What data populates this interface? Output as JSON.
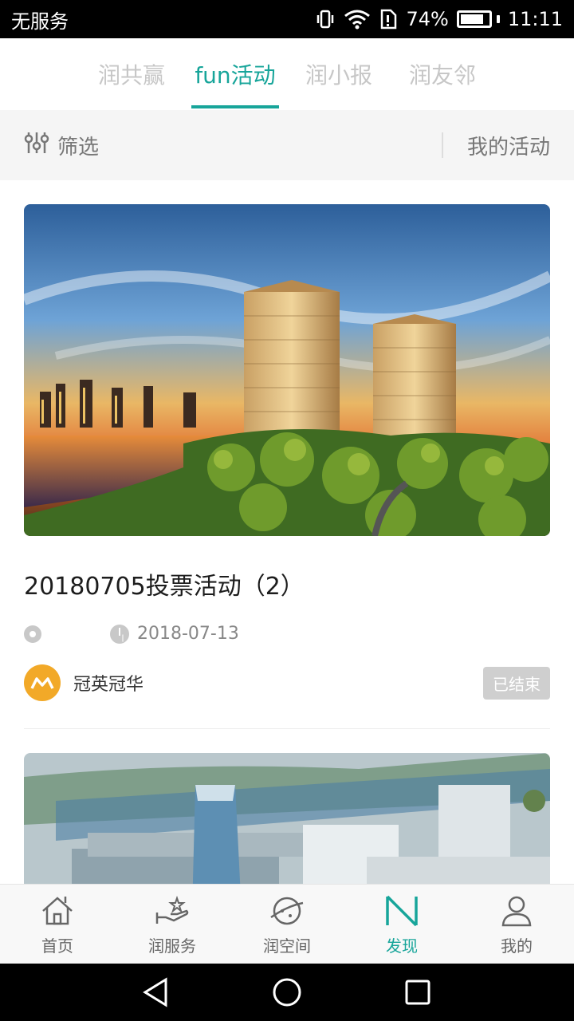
{
  "status_bar": {
    "carrier": "无服务",
    "battery_percent": "74%",
    "battery_level": 0.74,
    "time": "11:11",
    "icons": [
      "vibrate-icon",
      "wifi-icon",
      "sim-alert-icon",
      "battery-icon"
    ]
  },
  "tabs": [
    {
      "label": "润共赢",
      "active": false
    },
    {
      "label": "fun活动",
      "active": true
    },
    {
      "label": "润小报",
      "active": false
    },
    {
      "label": "润友邻",
      "active": false
    }
  ],
  "filter_bar": {
    "filter_label": "筛选",
    "my_activities_label": "我的活动"
  },
  "activities": [
    {
      "title": "20180705投票活动（2）",
      "location": "",
      "date": "2018-07-13",
      "organizer": "冠英冠华",
      "status": "已结束"
    }
  ],
  "bottom_nav": [
    {
      "label": "首页",
      "icon": "home-icon",
      "active": false
    },
    {
      "label": "润服务",
      "icon": "service-hand-icon",
      "active": false
    },
    {
      "label": "润空间",
      "icon": "planet-icon",
      "active": false
    },
    {
      "label": "发现",
      "icon": "discover-icon",
      "active": true
    },
    {
      "label": "我的",
      "icon": "profile-icon",
      "active": false
    }
  ],
  "colors": {
    "accent": "#17a59a",
    "inactive_tab": "#c7c7c7",
    "status_badge": "#cfcfcf"
  }
}
